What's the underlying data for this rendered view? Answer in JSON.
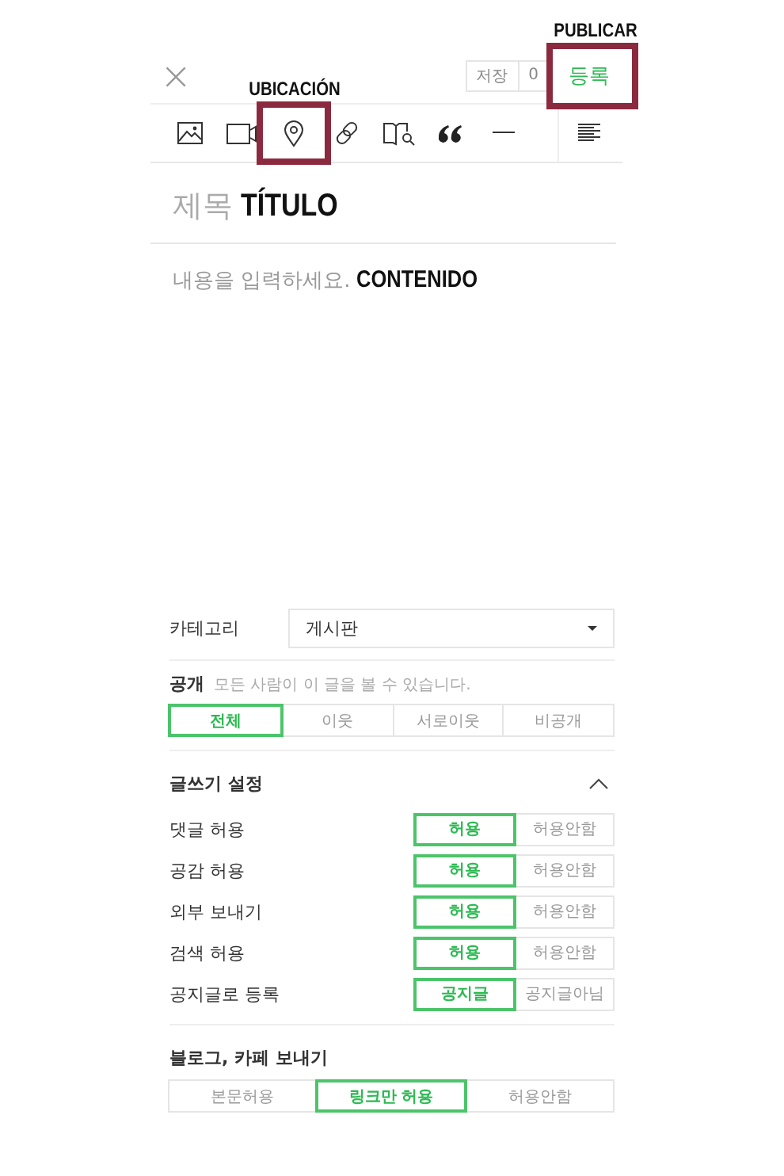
{
  "header": {
    "close": "×",
    "save_button": {
      "label": "저장"
    },
    "save_count": "0",
    "publish_button": {
      "label": "등록",
      "annotation": "PUBLICAR"
    }
  },
  "toolbar": {
    "tools": [
      {
        "kind": "image"
      },
      {
        "kind": "video"
      },
      {
        "kind": "location",
        "annotation": "UBICACIÓN"
      },
      {
        "kind": "link"
      },
      {
        "kind": "library"
      },
      {
        "kind": "quote"
      },
      {
        "kind": "divider"
      }
    ]
  },
  "title": {
    "placeholder": "제목",
    "annotation": "TÍTULO"
  },
  "content": {
    "placeholder": "내용을 입력하세요.",
    "annotation": "CONTENIDO"
  },
  "category": {
    "label": "카테고리",
    "value": "게시판"
  },
  "visibility": {
    "label": "공개",
    "hint": "모든 사람이 이 글을 볼 수 있습니다.",
    "options": [
      {
        "label": "전체",
        "selected": true
      },
      {
        "label": "이웃",
        "selected": false
      },
      {
        "label": "서로이웃",
        "selected": false
      },
      {
        "label": "비공개",
        "selected": false
      }
    ]
  },
  "writing_settings": {
    "title": "글쓰기 설정",
    "expanded": true,
    "rows": [
      {
        "label": "댓글 허용",
        "options": [
          {
            "label": "허용",
            "selected": true
          },
          {
            "label": "허용안함",
            "selected": false
          }
        ]
      },
      {
        "label": "공감 허용",
        "options": [
          {
            "label": "허용",
            "selected": true
          },
          {
            "label": "허용안함",
            "selected": false
          }
        ]
      },
      {
        "label": "외부 보내기",
        "options": [
          {
            "label": "허용",
            "selected": true
          },
          {
            "label": "허용안함",
            "selected": false
          }
        ]
      },
      {
        "label": "검색 허용",
        "options": [
          {
            "label": "허용",
            "selected": true
          },
          {
            "label": "허용안함",
            "selected": false
          }
        ]
      },
      {
        "label": "공지글로 등록",
        "options": [
          {
            "label": "공지글",
            "selected": true
          },
          {
            "label": "공지글아님",
            "selected": false
          }
        ]
      }
    ]
  },
  "share": {
    "title": "블로그, 카페 보내기",
    "options": [
      {
        "label": "본문허용",
        "selected": false
      },
      {
        "label": "링크만 허용",
        "selected": true
      },
      {
        "label": "허용안함",
        "selected": false
      }
    ]
  }
}
